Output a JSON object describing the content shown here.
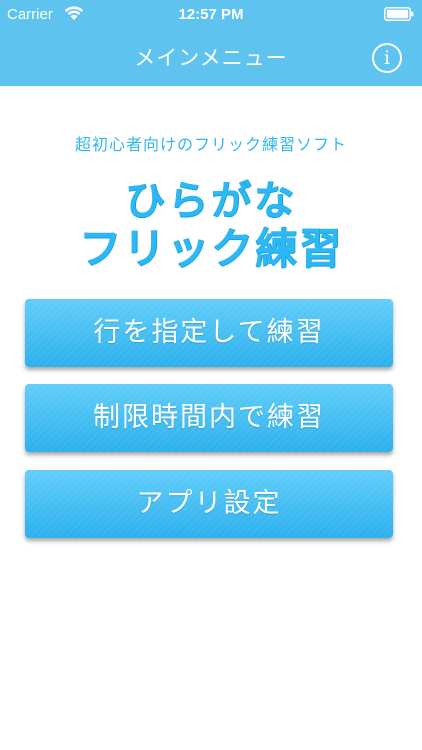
{
  "status_bar": {
    "carrier": "Carrier",
    "time": "12:57 PM",
    "wifi_icon": "wifi-icon",
    "battery_icon": "battery-icon"
  },
  "nav": {
    "title": "メインメニュー",
    "info_icon": "info-icon",
    "info_glyph": "i"
  },
  "header": {
    "subtitle": "超初心者向けのフリック練習ソフト",
    "title_line1": "ひらがな",
    "title_line2": "フリック練習"
  },
  "menu": {
    "items": [
      {
        "label": "行を指定して練習"
      },
      {
        "label": "制限時間内で練習"
      },
      {
        "label": "アプリ設定"
      }
    ]
  },
  "colors": {
    "accent": "#5fc3f0",
    "title_blue": "#2cb8f4",
    "button_top": "#62cdfa",
    "button_bottom": "#2ab0ec"
  }
}
